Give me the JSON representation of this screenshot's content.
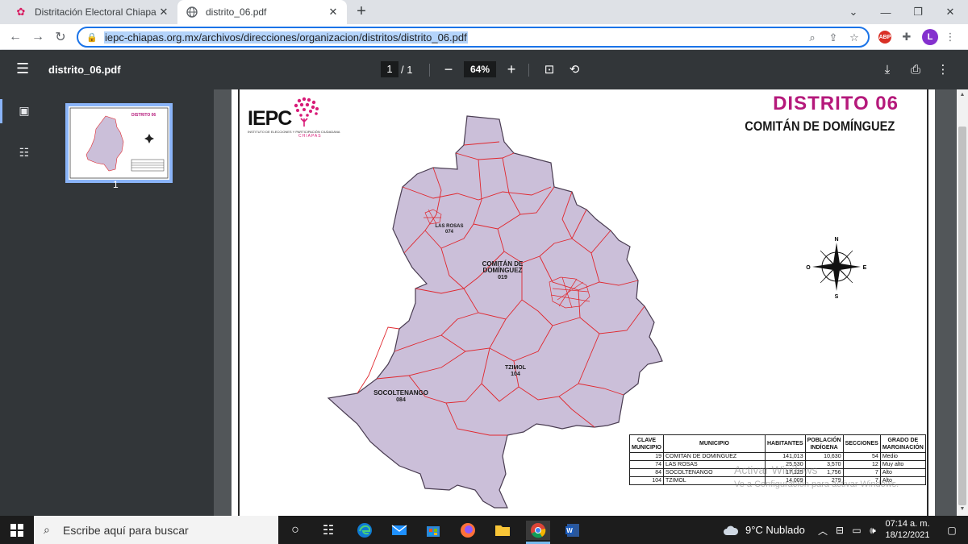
{
  "browser": {
    "tabs": [
      {
        "title": "Distritación Electoral Chiapas",
        "icon": "chiapas-flower-icon",
        "active": false
      },
      {
        "title": "distrito_06.pdf",
        "icon": "globe-icon",
        "active": true
      }
    ],
    "new_tab": "+",
    "close_glyph": "✕",
    "url": "iepc-chiapas.org.mx/archivos/direcciones/organizacion/distritos/distrito_06.pdf",
    "profile_initial": "L",
    "adblock_label": "ABP"
  },
  "pdf": {
    "file_name": "distrito_06.pdf",
    "current_page": "1",
    "total_pages": "/  1",
    "zoom": "64%",
    "thumbnail_page": "1"
  },
  "document": {
    "logo": "IEPC",
    "logo_caption": "INSTITUTO DE ELECCIONES Y PARTICIPACIÓN CIUDADANA",
    "logo_state": "CHIAPAS",
    "title": "DISTRITO 06",
    "subtitle": "COMITÁN DE DOMÍNGUEZ",
    "map_labels": {
      "comitan": [
        "COMITÁN DE",
        "DOMÍNGUEZ",
        "019"
      ],
      "las_rosas": [
        "LAS ROSAS",
        "074"
      ],
      "tzimol": [
        "TZIMOL",
        "104"
      ],
      "socoltenango": [
        "SOCOLTENANGO",
        "084"
      ]
    },
    "compass": {
      "n": "N",
      "s": "S",
      "e": "E",
      "o": "O"
    },
    "table": {
      "headers": [
        "CLAVE MUNICIPIO",
        "MUNICIPIO",
        "HABITANTES",
        "POBLACIÓN INDÍGENA",
        "SECCIONES",
        "GRADO DE MARGINACIÓN"
      ],
      "rows": [
        [
          "19",
          "COMITAN DE DOMINGUEZ",
          "141,013",
          "10,630",
          "54",
          "Medio"
        ],
        [
          "74",
          "LAS ROSAS",
          "25,530",
          "3,570",
          "12",
          "Muy alto"
        ],
        [
          "84",
          "SOCOLTENANGO",
          "17,125",
          "1,756",
          "7",
          "Alto"
        ],
        [
          "104",
          "TZIMOL",
          "14,009",
          "279",
          "7",
          "Alto"
        ]
      ]
    }
  },
  "watermark": {
    "line1": "Activar Windows",
    "line2": "Ve a Configuración para activar Windows."
  },
  "taskbar": {
    "search_placeholder": "Escribe aquí para buscar",
    "weather": "9°C  Nublado",
    "time": "07:14 a. m.",
    "date": "18/12/2021"
  },
  "colors": {
    "accent": "#1a73e8",
    "district_title": "#b5197b",
    "map_fill": "#cbbfd9",
    "map_border": "#e0272e"
  }
}
